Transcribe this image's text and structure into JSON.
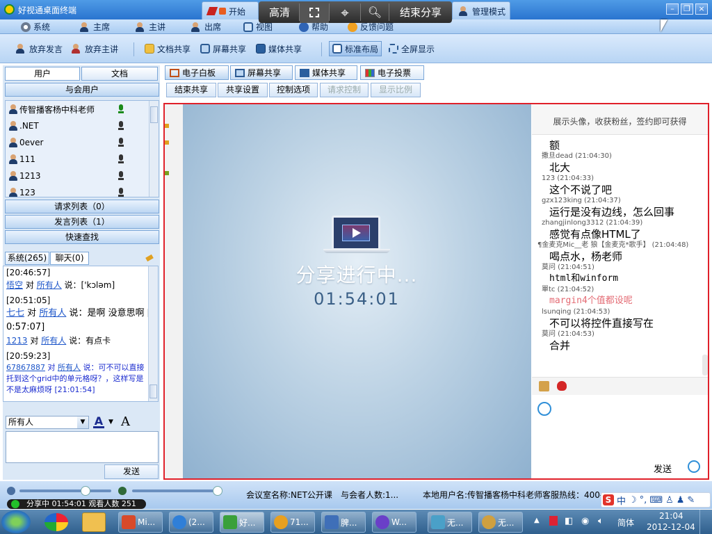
{
  "app": {
    "title": "好视通桌面终端"
  },
  "sharebar": {
    "start": "开始",
    "quality": "高清",
    "stop": "结束分享",
    "admin": "管理模式"
  },
  "menu": [
    {
      "label": "系统",
      "icon": "gear-icon"
    },
    {
      "label": "主席",
      "icon": "user-icon"
    },
    {
      "label": "主讲",
      "icon": "user-icon"
    },
    {
      "label": "出席",
      "icon": "user-icon"
    },
    {
      "label": "视图",
      "icon": "monitor-icon"
    },
    {
      "label": "帮助",
      "icon": "info-icon"
    },
    {
      "label": "反馈问题",
      "icon": "feedback-icon"
    }
  ],
  "toolbar": {
    "give_up_speak": "放弃发言",
    "give_up_host": "放弃主讲",
    "doc_share": "文档共享",
    "screen_share": "屏幕共享",
    "media_share": "媒体共享",
    "standard_layout": "标准布局",
    "fullscreen": "全屏显示"
  },
  "left": {
    "tab_users": "用户",
    "tab_docs": "文档",
    "attendees": "与会用户",
    "users": [
      {
        "name": "传智播客杨中科老师",
        "mic": "on"
      },
      {
        "name": ".NET",
        "mic": "off"
      },
      {
        "name": "0ever",
        "mic": "off"
      },
      {
        "name": "111",
        "mic": "off"
      },
      {
        "name": "1213",
        "mic": "off"
      },
      {
        "name": "123",
        "mic": "off"
      }
    ],
    "request_list": "请求列表（0）",
    "speak_list": "发言列表（1）",
    "quick_search": "快速查找",
    "chat_tab_system": "系统(265)",
    "chat_tab_chat": "聊天(0)",
    "chat": [
      {
        "time": "[20:46:57]"
      },
      {
        "from": "悟空",
        "to_word": "对",
        "to": "所有人",
        "say": "说：['kɔləm]"
      },
      {
        "time": "[20:51:05]"
      },
      {
        "from": "七七",
        "to_word": "对",
        "to": "所有人",
        "say": "说：是啊 没意思啊 [20:57:07]"
      },
      {
        "from": "1213",
        "to_word": "对",
        "to": "所有人",
        "say": "说：有点卡"
      },
      {
        "time": "[20:59:23]"
      },
      {
        "from": "67867887",
        "to_word": "对",
        "to": "所有人",
        "say": "说：可不可以直接托到这个grid中的单元格呀？，这样写是不是太麻烦呀 [21:01:54]"
      }
    ],
    "recipient": "所有人",
    "send": "发送"
  },
  "main": {
    "tabs": [
      {
        "label": "电子白板",
        "icon": "whiteboard-icon"
      },
      {
        "label": "屏幕共享",
        "icon": "screen-icon"
      },
      {
        "label": "媒体共享",
        "icon": "media-icon"
      },
      {
        "label": "电子投票",
        "icon": "vote-icon"
      }
    ],
    "subbuttons": [
      {
        "label": "结束共享",
        "disabled": false
      },
      {
        "label": "共享设置",
        "disabled": false
      },
      {
        "label": "控制选项",
        "disabled": false
      },
      {
        "label": "请求控制",
        "disabled": true
      },
      {
        "label": "显示比例",
        "disabled": true
      }
    ],
    "sharing_text": "分享进行中...",
    "sharing_time": "01:54:01"
  },
  "right_chat": {
    "banner": "展示头像，收获粉丝，签约即可获得",
    "messages": [
      {
        "text": "额",
        "meta": "撒旦dead (21:04:30)"
      },
      {
        "text": "北大",
        "meta": "123 (21:04:33)"
      },
      {
        "text": "这个不说了吧",
        "meta": "gzx123king (21:04:37)"
      },
      {
        "text": "运行是没有边线，怎么回事",
        "meta": "zhangjinlong3312 (21:04:39)"
      },
      {
        "text": "感觉有点像HTML了",
        "meta": "¶金麦克Mic__老 狼【金麦克*歌手】 (21:04:48)"
      },
      {
        "text": "喝点水，杨老师",
        "meta": "莫问 (21:04:51)"
      },
      {
        "text": "html和winform",
        "meta": "單tc (21:04:52)"
      },
      {
        "text": "margin4个值都设呢",
        "meta": "lsunqing (21:04:53)",
        "color": "#e46b74"
      },
      {
        "text": "不可以将控件直接写在",
        "meta": "莫问 (21:04:53)"
      },
      {
        "text": "合并",
        "meta": ""
      }
    ],
    "send": "发送"
  },
  "status": {
    "room": "会议室名称:NET公开课",
    "count": "与会者人数:1...",
    "local_user": "本地用户名:传智播客杨中科老师",
    "hotline": "客服热线：400-",
    "share_status": "分享中  01:54:01  观看人数 251"
  },
  "taskbar": {
    "items": [
      {
        "label": "Mi...",
        "color": "#d84a2a"
      },
      {
        "label": "(2...",
        "color": "#2f7fd8"
      },
      {
        "label": "好...",
        "color": "#3aa03a"
      },
      {
        "label": "71...",
        "color": "#e8a020"
      },
      {
        "label": "脾...",
        "color": "#3f6fb8"
      },
      {
        "label": "W...",
        "color": "#6a3fc8"
      },
      {
        "label": "无...",
        "color": "#4aa0c8"
      },
      {
        "label": "无...",
        "color": "#d0a040"
      }
    ],
    "ime": "简体",
    "time": "21:04",
    "date": "2012-12-04",
    "ime_bar": "中"
  }
}
